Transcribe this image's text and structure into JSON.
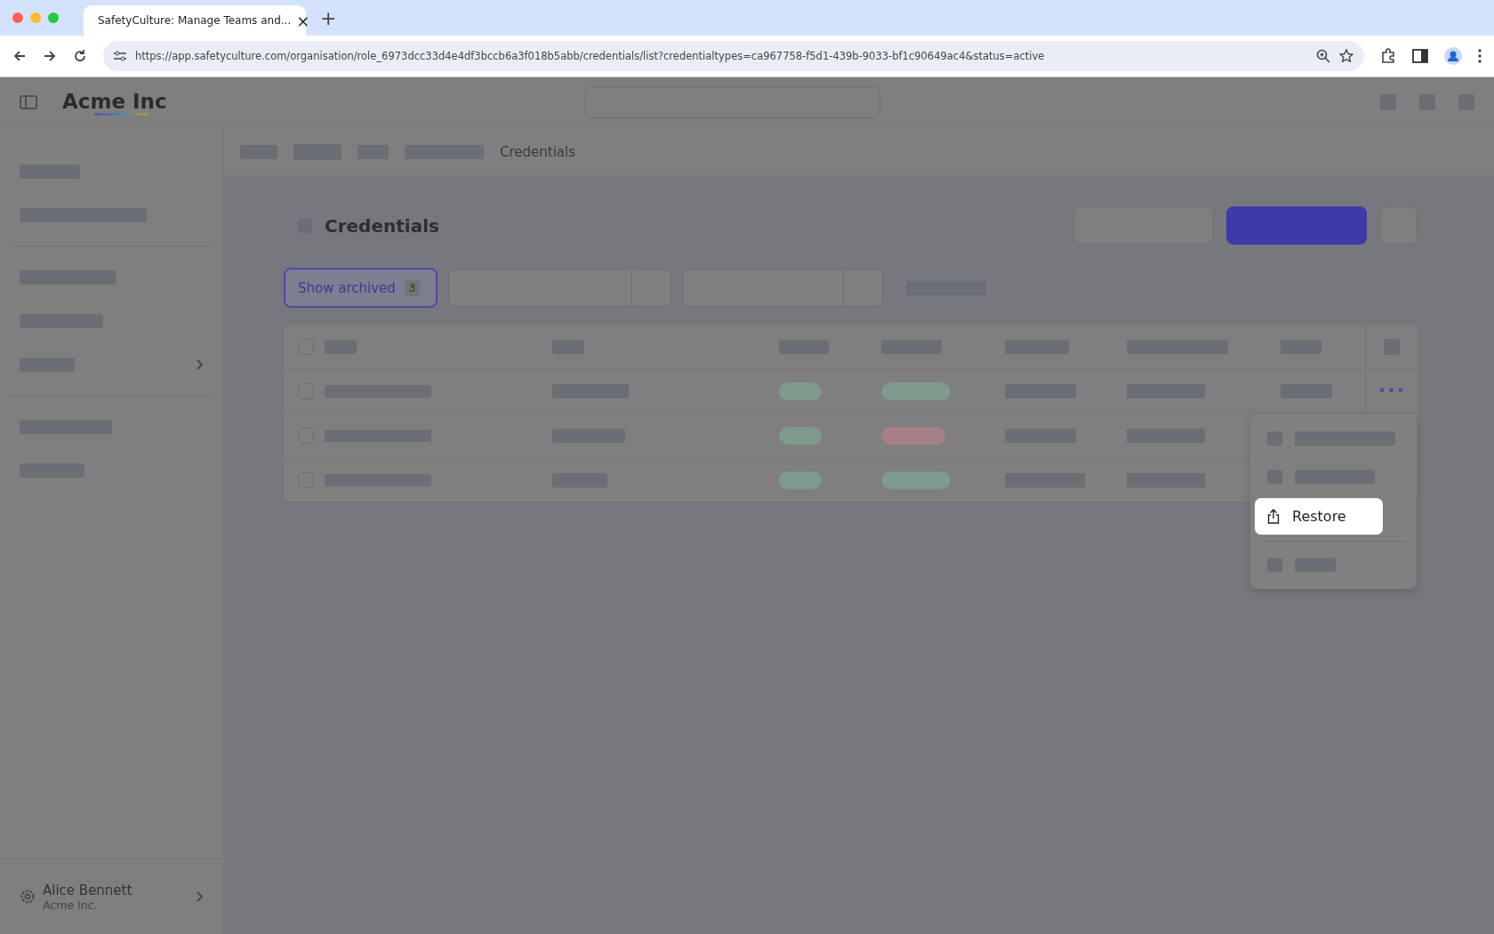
{
  "browser": {
    "tab_title": "SafetyCulture: Manage Teams and...",
    "tab_close": "×",
    "new_tab": "+",
    "url": "https://app.safetyculture.com/organisation/role_6973dcc33d4e4df3bccb6a3f018b5abb/credentials/list?credentialtypes=ca967758-f5d1-439b-9033-bf1c90649ac4&status=active"
  },
  "header": {
    "logo": "Acme Inc"
  },
  "breadcrumb": {
    "current": "Credentials"
  },
  "page": {
    "title": "Credentials"
  },
  "filter": {
    "label": "Show archived",
    "count": "3",
    "selected": true
  },
  "table": {
    "header_checked": false,
    "more_button": "•••",
    "rows": [
      {
        "color": "#7d9a8c",
        "checked": false
      },
      {
        "color": "#a48084",
        "checked": false
      },
      {
        "color": "#7d9a8c",
        "checked": false
      }
    ]
  },
  "menu": {
    "items": [
      {
        "kind": "placeholder"
      },
      {
        "kind": "placeholder"
      },
      {
        "kind": "action",
        "label": "Restore",
        "selected": true
      },
      {
        "kind": "placeholder"
      }
    ]
  },
  "user": {
    "name": "Alice Bennett",
    "org": "Acme Inc."
  }
}
